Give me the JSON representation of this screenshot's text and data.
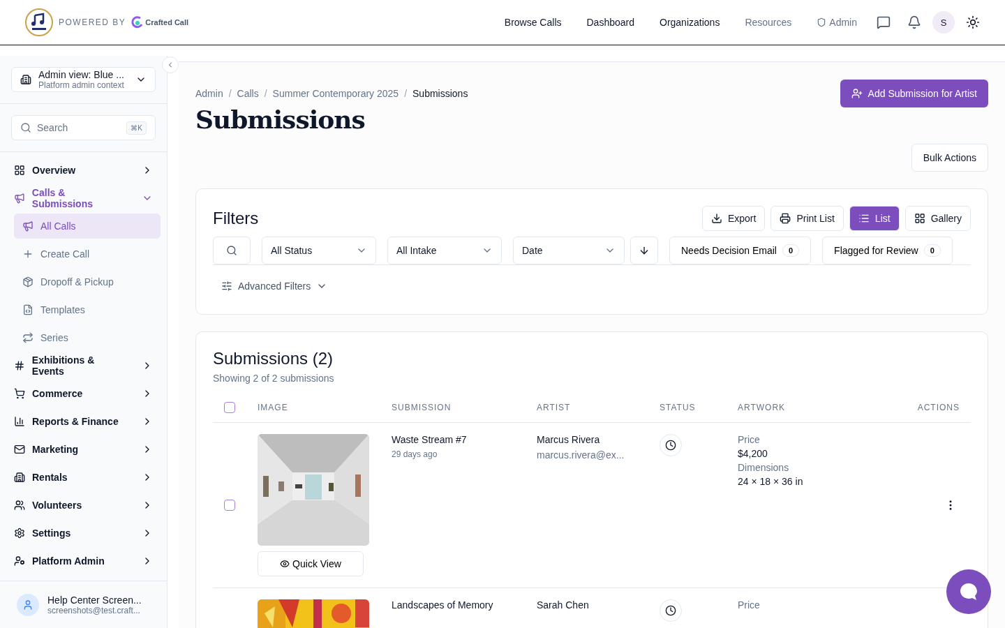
{
  "brand": {
    "powered_by": "POWERED BY",
    "partner": "Crafted Call"
  },
  "nav": [
    {
      "label": "Browse Calls",
      "muted": false,
      "kind": "link"
    },
    {
      "label": "Dashboard",
      "muted": false,
      "kind": "link"
    },
    {
      "label": "Organizations",
      "muted": false,
      "kind": "link"
    },
    {
      "label": "Resources",
      "muted": true,
      "kind": "link"
    },
    {
      "label": "Admin",
      "muted": true,
      "kind": "shield"
    }
  ],
  "avatar": "S",
  "sidebar": {
    "context": {
      "title": "Admin view: Blue ...",
      "subtitle": "Platform admin context"
    },
    "search": {
      "placeholder": "Search",
      "shortcut": "⌘K"
    },
    "items": [
      {
        "label": "Overview",
        "expanded": false
      },
      {
        "label": "Calls & Submissions",
        "expanded": true,
        "children": [
          {
            "label": "All Calls",
            "selected": true
          },
          {
            "label": "Create Call",
            "selected": false
          },
          {
            "label": "Dropoff & Pickup",
            "selected": false
          },
          {
            "label": "Templates",
            "selected": false
          },
          {
            "label": "Series",
            "selected": false
          }
        ]
      },
      {
        "label": "Exhibitions & Events",
        "expanded": false
      },
      {
        "label": "Commerce",
        "expanded": false
      },
      {
        "label": "Reports & Finance",
        "expanded": false
      },
      {
        "label": "Marketing",
        "expanded": false
      },
      {
        "label": "Rentals",
        "expanded": false
      },
      {
        "label": "Volunteers",
        "expanded": false
      },
      {
        "label": "Settings",
        "expanded": false
      },
      {
        "label": "Platform Admin",
        "expanded": false
      }
    ],
    "user": {
      "name": "Help Center Screen...",
      "email": "screenshots@test.craft..."
    }
  },
  "breadcrumb": [
    {
      "label": "Admin",
      "current": false
    },
    {
      "separator": "/",
      "label": "Calls",
      "current": false
    },
    {
      "separator": "/",
      "label": "Summer Contemporary 2025",
      "current": false
    },
    {
      "separator": "/",
      "label": "Submissions",
      "current": true
    }
  ],
  "title": "Submissions",
  "add_button": "Add Submission for Artist",
  "bulk_button": "Bulk Actions",
  "filters": {
    "title": "Filters",
    "actions": [
      {
        "label": "Export",
        "selected": false
      },
      {
        "label": "Print List",
        "selected": false
      },
      {
        "label": "List",
        "selected": true
      },
      {
        "label": "Gallery",
        "selected": false
      }
    ],
    "selects": [
      "All Status",
      "All Intake",
      "Date"
    ],
    "toggles": [
      {
        "label": "Needs Decision Email",
        "count": "0"
      },
      {
        "label": "Flagged for Review",
        "count": "0"
      }
    ],
    "advanced": "Advanced Filters"
  },
  "table": {
    "title": "Submissions (2)",
    "subtitle": "Showing 2 of 2 submissions",
    "all_checked": false,
    "columns": [
      "IMAGE",
      "SUBMISSION",
      "ARTIST",
      "STATUS",
      "ARTWORK",
      "ACTIONS"
    ],
    "quick_view": "Quick View",
    "rows": [
      {
        "checked": false,
        "title": "Waste Stream #7",
        "age": "29 days ago",
        "artist": "Marcus Rivera",
        "email": "marcus.rivera@ex...",
        "price_label": "Price",
        "price": "$4,200",
        "dim_label": "Dimensions",
        "dims": "24 × 18 × 36 in"
      },
      {
        "title": "Landscapes of Memory",
        "artist": "Sarah Chen",
        "price_label": "Price"
      }
    ]
  }
}
